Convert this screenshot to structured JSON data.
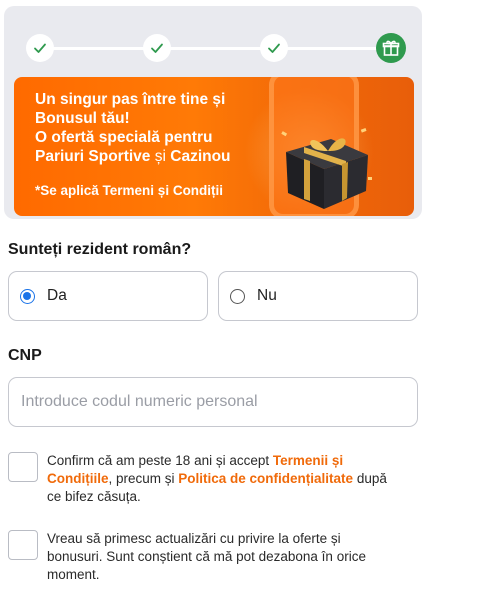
{
  "stepper": {
    "steps": [
      {
        "state": "done",
        "icon": "check-icon"
      },
      {
        "state": "done",
        "icon": "check-icon"
      },
      {
        "state": "done",
        "icon": "check-icon"
      },
      {
        "state": "current",
        "icon": "gift-icon"
      }
    ],
    "accent_color": "#2f9a4e"
  },
  "banner": {
    "line1": "Un singur pas între tine și",
    "line2": "Bonusul tău!",
    "line3": "O ofertă specială pentru",
    "line4_part1": "Pariuri Sportive",
    "line4_part2": " și ",
    "line4_part3": "Cazinou",
    "note": "*Se aplică Termeni și Condiții",
    "color": "#ff6a00"
  },
  "resident": {
    "question": "Sunteți rezident român?",
    "options": [
      {
        "label": "Da",
        "checked": true
      },
      {
        "label": "Nu",
        "checked": false
      }
    ]
  },
  "cnp": {
    "label": "CNP",
    "value": "",
    "placeholder": "Introduce codul numeric personal"
  },
  "consents": [
    {
      "text_before": "Confirm că am peste 18 ani și accept ",
      "link1": "Termenii și Condițiile",
      "text_middle": ", precum și ",
      "link2": "Politica de confidențialitate",
      "text_after": " după ce bifez căsuța.",
      "checked": false
    },
    {
      "text": "Vreau să primesc actualizări cu privire la oferte și bonusuri. Sunt conștient că mă pot dezabona în orice moment.",
      "checked": false
    }
  ],
  "link_color": "#f06a0a"
}
